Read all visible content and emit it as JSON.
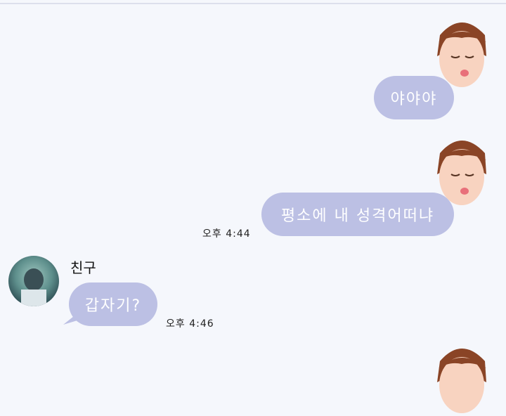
{
  "chat": {
    "messages": [
      {
        "direction": "outgoing",
        "text": "야야야",
        "sticker": "kiss-face-sticker"
      },
      {
        "direction": "outgoing",
        "text": "평소에 내 성격어떠냐",
        "time": "오후 4:44",
        "sticker": "kiss-face-sticker"
      },
      {
        "direction": "incoming",
        "sender": "친구",
        "text": "갑자기?",
        "time": "오후 4:46",
        "avatar": "friend-avatar"
      },
      {
        "direction": "outgoing",
        "sticker": "kiss-face-sticker"
      }
    ]
  },
  "colors": {
    "background": "#f5f7fc",
    "bubble": "#bcc0e4",
    "bubble_text": "#ffffff"
  }
}
